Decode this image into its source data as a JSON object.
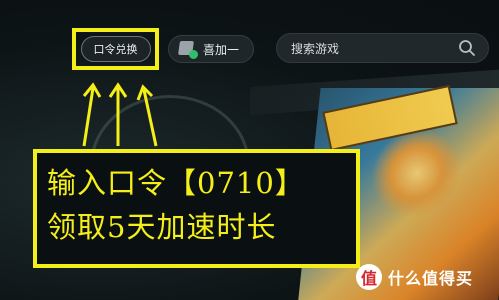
{
  "topbar": {
    "code_redeem_label": "口令兑换",
    "plus_one_label": "喜加一",
    "search_placeholder": "搜索游戏"
  },
  "promo": {
    "line1": "输入口令【0710】",
    "line2": "领取5天加速时长"
  },
  "watermark": {
    "logo_glyph": "值",
    "text": "什么值得买"
  },
  "colors": {
    "highlight": "#f4ef18",
    "background": "#0e1417",
    "plus_one_badge": "#2fbf6a",
    "watermark_logo": "#d6262f"
  },
  "icons": {
    "plus_one": "gift-plus-icon",
    "search": "search-icon",
    "arrows": "up-arrow-icon"
  }
}
